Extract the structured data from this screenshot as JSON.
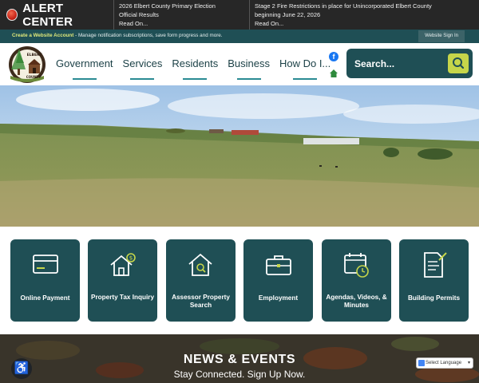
{
  "alert": {
    "title": "ALERT CENTER",
    "items": [
      {
        "line1": "2026 Elbert County Primary Election",
        "line2": "Official Results",
        "read": "Read On..."
      },
      {
        "line1": "Stage 2 Fire Restrictions in place for Unincorporated Elbert County",
        "line2": "beginning June 22, 2026",
        "read": "Read On..."
      }
    ]
  },
  "account": {
    "link": "Create a Website Account",
    "text": " - Manage notification subscriptions, save form progress and more.",
    "signin": "Website Sign In"
  },
  "logo": {
    "top": "ELBERT",
    "bottom": "COUNTY"
  },
  "nav": [
    "Government",
    "Services",
    "Residents",
    "Business",
    "How Do I..."
  ],
  "search": {
    "label": "Search..."
  },
  "tiles": [
    {
      "label": "Online Payment",
      "icon": "credit-card-icon"
    },
    {
      "label": "Property Tax Inquiry",
      "icon": "house-dollar-icon"
    },
    {
      "label": "Assessor Property Search",
      "icon": "house-search-icon"
    },
    {
      "label": "Employment",
      "icon": "briefcase-icon"
    },
    {
      "label": "Agendas, Videos, & Minutes",
      "icon": "calendar-clock-icon"
    },
    {
      "label": "Building Permits",
      "icon": "document-pen-icon"
    }
  ],
  "news": {
    "title": "NEWS & EVENTS",
    "subtitle": "Stay Connected. Sign Up Now."
  },
  "language": {
    "label": "Select Language"
  },
  "colors": {
    "primary": "#1f4f55",
    "accent": "#c6d64a",
    "alert_bar": "#272727"
  }
}
